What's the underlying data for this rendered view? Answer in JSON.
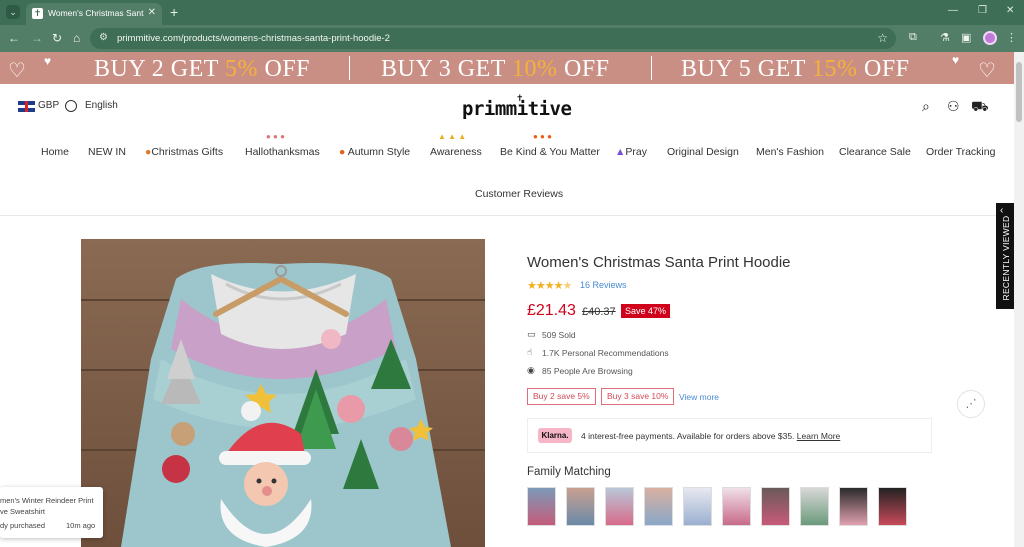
{
  "browser": {
    "tab_title": "Women's Christmas Santa Prin",
    "url": "primmitive.com/products/womens-christmas-santa-print-hoodie-2"
  },
  "promo": {
    "seg1_pre": "BUY 2 GET ",
    "seg1_pct": "5%",
    "seg1_post": " OFF",
    "seg2_pre": "BUY 3 GET ",
    "seg2_pct": "10%",
    "seg2_post": " OFF",
    "seg3_pre": "BUY 5 GET ",
    "seg3_pct": "15%",
    "seg3_post": " OFF",
    "accent_color": "#f5b13a",
    "bg_color": "#c98f84"
  },
  "header": {
    "currency": "GBP",
    "language": "English",
    "logo": "primmitive"
  },
  "nav": {
    "home": "Home",
    "new_in": "NEW IN",
    "christmas_gifts": "Christmas Gifts",
    "hallothanksmas": "Hallothanksmas",
    "autumn_style": "Autumn Style",
    "awareness": "Awareness",
    "be_kind": "Be Kind & You Matter",
    "pray": "Pray",
    "original_design": "Original Design",
    "mens_fashion": "Men's Fashion",
    "clearance_sale": "Clearance Sale",
    "order_tracking": "Order Tracking",
    "customer_reviews": "Customer Reviews"
  },
  "product": {
    "title": "Women's Christmas Santa Print Hoodie",
    "rating": 4.5,
    "reviews": "16 Reviews",
    "price": "£21.43",
    "old_price": "£40.37",
    "save": "Save 47%",
    "sold": "509 Sold",
    "recommendations": "1.7K Personal Recommendations",
    "browsing": "85 People Are Browsing",
    "offer1": "Buy 2 save 5%",
    "offer2": "Buy 3 save 10%",
    "view_more": "View more",
    "klarna_badge": "Klarna.",
    "klarna_text": "4 interest-free payments. Available for orders above $35.",
    "klarna_link": "Learn More",
    "family_matching": "Family Matching"
  },
  "sidebar": {
    "recently_viewed": "RECENTLY VIEWED"
  },
  "popup": {
    "line1": "men's Winter Reindeer Print",
    "line2": "ve Sweatshirt",
    "line3": "dy purchased",
    "time": "10m ago"
  }
}
